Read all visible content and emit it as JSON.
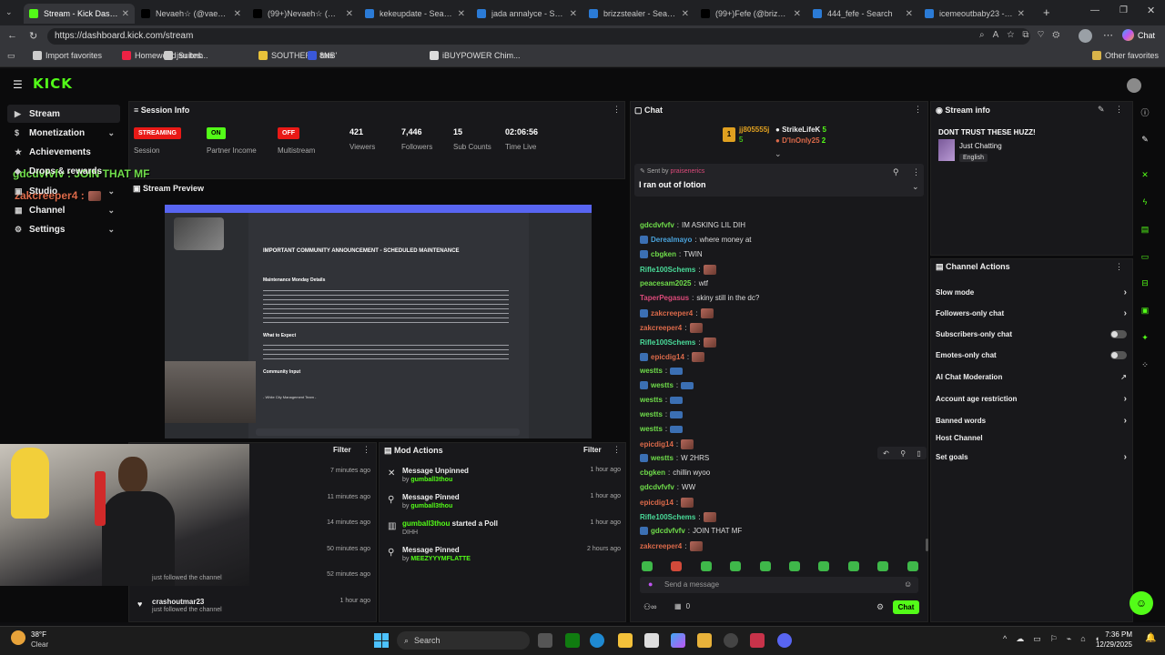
{
  "browser": {
    "tabs": [
      {
        "title": "Stream - Kick Dashboard",
        "active": true
      },
      {
        "title": "Nevaeh☆ (@vaeh.lache"
      },
      {
        "title": "(99+)Nevaeh☆ (@vaeh."
      },
      {
        "title": "kekeupdate - Search"
      },
      {
        "title": "jada annalyce - Search"
      },
      {
        "title": "brizzstealer - Search"
      },
      {
        "title": "(99+)Fefe (@brizzsteale"
      },
      {
        "title": "444_fefe - Search"
      },
      {
        "title": "icemeoutbaby23 - Search"
      }
    ],
    "url": "https://dashboard.kick.com/stream",
    "profile_label": "Chat",
    "bookmarks": [
      "Import favorites",
      "Homewood Suites...",
      "jsu bnb",
      "SOUTHERN 8NB'",
      "tats",
      "iBUYPOWER Chim..."
    ],
    "other_favorites": "Other favorites"
  },
  "kick": {
    "logo": "KICK",
    "nav": [
      {
        "label": "Stream",
        "active": true
      },
      {
        "label": "Monetization",
        "chevron": true
      },
      {
        "label": "Achievements"
      },
      {
        "label": "Drops & rewards"
      },
      {
        "label": "Studio",
        "chevron": true
      },
      {
        "label": "Channel",
        "chevron": true
      },
      {
        "label": "Settings",
        "chevron": true
      }
    ],
    "overlay_lines": [
      "gdcdvfvfv : JOIN THAT MF",
      "zakcreeper4 :"
    ],
    "session": {
      "title": "Session Info",
      "streaming_badge": "STREAMING",
      "session_label": "Session",
      "partner_badge": "ON",
      "partner_label": "Partner Income",
      "multi_badge": "OFF",
      "multi_label": "Multistream",
      "stats": [
        {
          "value": "421",
          "label": "Viewers"
        },
        {
          "value": "7,446",
          "label": "Followers"
        },
        {
          "value": "15",
          "label": "Sub Counts"
        },
        {
          "value": "02:06:56",
          "label": "Time Live"
        }
      ]
    },
    "preview_title": "Stream Preview",
    "preview": {
      "announcement": "IMPORTANT COMMUNITY ANNOUNCEMENT - SCHEDULED MAINTENANCE",
      "section1": "Maintenance Monday Details",
      "section2": "What to Expect",
      "section3": "Community Input",
      "footer": "- White City Management Team -"
    },
    "activity": {
      "filter": "Filter",
      "rows": [
        {
          "time": "7 minutes ago"
        },
        {
          "time": "11 minutes ago"
        },
        {
          "time": "14 minutes ago"
        },
        {
          "time": "50 minutes ago"
        },
        {
          "sub": "just followed the channel",
          "time": "52 minutes ago"
        },
        {
          "name": "crashoutmar23",
          "sub": "just followed the channel",
          "time": "1 hour ago"
        }
      ]
    },
    "mod_actions": {
      "title": "Mod Actions",
      "filter": "Filter",
      "rows": [
        {
          "title": "Message Unpinned",
          "by": "by ",
          "user": "gumball3thou",
          "time": "1 hour ago"
        },
        {
          "title": "Message Pinned",
          "by": "by ",
          "user": "gumball3thou",
          "time": "1 hour ago"
        },
        {
          "user": "gumball3thou",
          "title": " started a Poll",
          "sub": "DIHH",
          "time": "1 hour ago"
        },
        {
          "title": "Message Pinned",
          "by": "by ",
          "user": "MEEZYYYMFLATTE",
          "time": "2 hours ago"
        }
      ]
    },
    "chat": {
      "title": "Chat",
      "top_gifters": [
        {
          "name": "jj805555j",
          "count": "5"
        },
        {
          "name": "StrikeLifeK",
          "count": "5"
        },
        {
          "name": "D'lnOnly25",
          "count": "2"
        }
      ],
      "pinned_label": "Sent by",
      "pinned_user": "praisenerics",
      "pinned_text": "I ran out of lotion",
      "messages": [
        {
          "user": "gdcdvfvfv",
          "text": "IM ASKING LIL DIH",
          "color": "#6fdc4a"
        },
        {
          "user": "Derealmayo",
          "text": "where money at",
          "color": "#4aa3dc"
        },
        {
          "user": "cbgken",
          "text": "TWIN",
          "color": "#6fdc4a"
        },
        {
          "user": "Rifle100Schems",
          "text": "",
          "color": "#4adc9a",
          "emote": true
        },
        {
          "user": "peacesam2025",
          "text": "wtf",
          "color": "#6fdc4a"
        },
        {
          "user": "TaperPegasus",
          "text": "skiny still in the dc?",
          "color": "#dc4a7a"
        },
        {
          "user": "zakcreeper4",
          "text": "",
          "color": "#dc6a4a",
          "emote": true
        },
        {
          "user": "zakcreeper4",
          "text": "",
          "color": "#dc6a4a",
          "emote": true
        },
        {
          "user": "Rifle100Schems",
          "text": "",
          "color": "#4adc9a",
          "emote": true
        },
        {
          "user": "epicdig14",
          "text": "",
          "color": "#dc6a4a",
          "emote": true
        },
        {
          "user": "westts",
          "text": "",
          "color": "#6fdc4a",
          "blue": true
        },
        {
          "user": "westts",
          "text": "",
          "color": "#6fdc4a",
          "blue": true
        },
        {
          "user": "westts",
          "text": "",
          "color": "#6fdc4a",
          "blue": true
        },
        {
          "user": "westts",
          "text": "",
          "color": "#6fdc4a",
          "blue": true
        },
        {
          "user": "westts",
          "text": "",
          "color": "#6fdc4a",
          "blue": true
        },
        {
          "user": "epicdig14",
          "text": "",
          "color": "#dc6a4a",
          "emote": true
        },
        {
          "user": "westts",
          "text": "W 2HRS",
          "color": "#6fdc4a"
        },
        {
          "user": "cbgken",
          "text": "chillin wyoo",
          "color": "#6fdc4a"
        },
        {
          "user": "gdcdvfvfv",
          "text": "WW",
          "color": "#6fdc4a"
        },
        {
          "user": "epicdig14",
          "text": "",
          "color": "#dc6a4a",
          "emote": true
        },
        {
          "user": "Rifle100Schems",
          "text": "",
          "color": "#4adc9a",
          "emote": true
        },
        {
          "user": "gdcdvfvfv",
          "text": "JOIN THAT MF",
          "color": "#6fdc4a"
        },
        {
          "user": "zakcreeper4",
          "text": "",
          "color": "#dc6a4a",
          "emote": true
        }
      ],
      "placeholder": "Send a message",
      "points": "0",
      "send_label": "Chat"
    },
    "stream_info": {
      "title": "Stream info",
      "stream_title": "DONT TRUST THESE HUZZ!",
      "category": "Just Chatting",
      "language": "English"
    },
    "channel_actions": {
      "title": "Channel Actions",
      "items": [
        {
          "label": "Slow mode",
          "kind": "chevron"
        },
        {
          "label": "Followers-only chat",
          "kind": "chevron"
        },
        {
          "label": "Subscribers-only chat",
          "kind": "toggle"
        },
        {
          "label": "Emotes-only chat",
          "kind": "toggle"
        },
        {
          "label": "AI Chat Moderation",
          "kind": "link"
        },
        {
          "label": "Account age restriction",
          "kind": "chevron"
        },
        {
          "label": "Banned words",
          "kind": "chevron"
        },
        {
          "label": "Host Channel",
          "kind": "none"
        },
        {
          "label": "Set goals",
          "kind": "chevron"
        }
      ]
    }
  },
  "taskbar": {
    "weather_temp": "38°F",
    "weather_desc": "Clear",
    "search_placeholder": "Search",
    "time": "7:36 PM",
    "date": "12/29/2025"
  },
  "colors": {
    "kick_green": "#53fc18",
    "streaming_red": "#e91916",
    "panel": "#18181b"
  }
}
